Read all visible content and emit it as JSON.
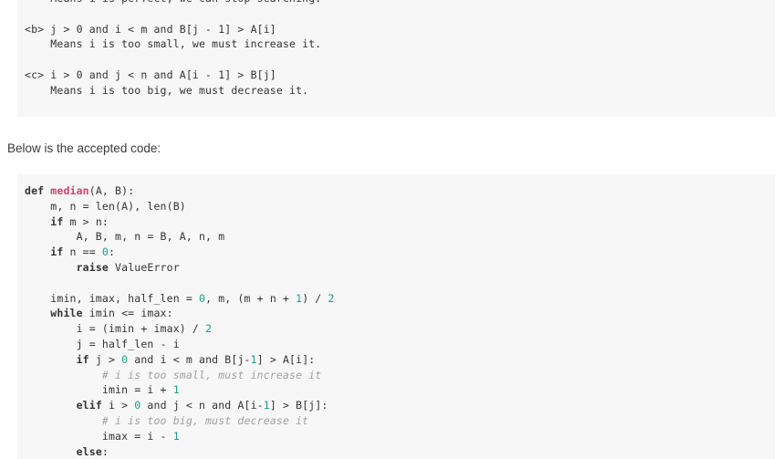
{
  "document": {
    "background_color": "#ffffff",
    "code_block_background": "#f7f7f7",
    "text_color": "#333333"
  },
  "colors": {
    "keyword": "#333333",
    "function_name": "#d1436b",
    "number": "#1a9e8f",
    "comment": "#a0a0a0",
    "plain": "#333333"
  },
  "conditions_block": {
    "name": "binary-search-conditions",
    "lines": [
      "    Means i is perfect, we can stop searching.",
      "",
      "<b> j > 0 and i < m and B[j - 1] > A[i]",
      "    Means i is too small, we must increase it.",
      "",
      "<c> i > 0 and j < n and A[i - 1] > B[j]",
      "    Means i is too big, we must decrease it."
    ]
  },
  "intro": {
    "text": "Below is the accepted code:"
  },
  "code_block": {
    "name": "accepted-python-solution",
    "language": "python",
    "lines": [
      [
        {
          "t": "def ",
          "c": "kw"
        },
        {
          "t": "median",
          "c": "fn"
        },
        {
          "t": "(A, B):",
          "c": "txt"
        }
      ],
      [
        {
          "t": "    m, n = len(A), len(B)",
          "c": "txt"
        }
      ],
      [
        {
          "t": "    ",
          "c": "txt"
        },
        {
          "t": "if",
          "c": "kw"
        },
        {
          "t": " m > n:",
          "c": "txt"
        }
      ],
      [
        {
          "t": "        A, B, m, n = B, A, n, m",
          "c": "txt"
        }
      ],
      [
        {
          "t": "    ",
          "c": "txt"
        },
        {
          "t": "if",
          "c": "kw"
        },
        {
          "t": " n == ",
          "c": "txt"
        },
        {
          "t": "0",
          "c": "num"
        },
        {
          "t": ":",
          "c": "txt"
        }
      ],
      [
        {
          "t": "        ",
          "c": "txt"
        },
        {
          "t": "raise",
          "c": "kw"
        },
        {
          "t": " ValueError",
          "c": "txt"
        }
      ],
      [
        {
          "t": "",
          "c": "txt"
        }
      ],
      [
        {
          "t": "    imin, imax, half_len = ",
          "c": "txt"
        },
        {
          "t": "0",
          "c": "num"
        },
        {
          "t": ", m, (m + n + ",
          "c": "txt"
        },
        {
          "t": "1",
          "c": "num"
        },
        {
          "t": ") / ",
          "c": "txt"
        },
        {
          "t": "2",
          "c": "num"
        }
      ],
      [
        {
          "t": "    ",
          "c": "txt"
        },
        {
          "t": "while",
          "c": "kw"
        },
        {
          "t": " imin <= imax:",
          "c": "txt"
        }
      ],
      [
        {
          "t": "        i = (imin + imax) / ",
          "c": "txt"
        },
        {
          "t": "2",
          "c": "num"
        }
      ],
      [
        {
          "t": "        j = half_len - i",
          "c": "txt"
        }
      ],
      [
        {
          "t": "        ",
          "c": "txt"
        },
        {
          "t": "if",
          "c": "kw"
        },
        {
          "t": " j > ",
          "c": "txt"
        },
        {
          "t": "0",
          "c": "num"
        },
        {
          "t": " and i < m and B[j-",
          "c": "txt"
        },
        {
          "t": "1",
          "c": "num"
        },
        {
          "t": "] > A[i]:",
          "c": "txt"
        }
      ],
      [
        {
          "t": "            # i is too small, must increase it",
          "c": "cmt"
        }
      ],
      [
        {
          "t": "            imin = i + ",
          "c": "txt"
        },
        {
          "t": "1",
          "c": "num"
        }
      ],
      [
        {
          "t": "        ",
          "c": "txt"
        },
        {
          "t": "elif",
          "c": "kw"
        },
        {
          "t": " i > ",
          "c": "txt"
        },
        {
          "t": "0",
          "c": "num"
        },
        {
          "t": " and j < n and A[i-",
          "c": "txt"
        },
        {
          "t": "1",
          "c": "num"
        },
        {
          "t": "] > B[j]:",
          "c": "txt"
        }
      ],
      [
        {
          "t": "            # i is too big, must decrease it",
          "c": "cmt"
        }
      ],
      [
        {
          "t": "            imax = i - ",
          "c": "txt"
        },
        {
          "t": "1",
          "c": "num"
        }
      ],
      [
        {
          "t": "        ",
          "c": "txt"
        },
        {
          "t": "else",
          "c": "kw"
        },
        {
          "t": ":",
          "c": "txt"
        }
      ]
    ]
  }
}
